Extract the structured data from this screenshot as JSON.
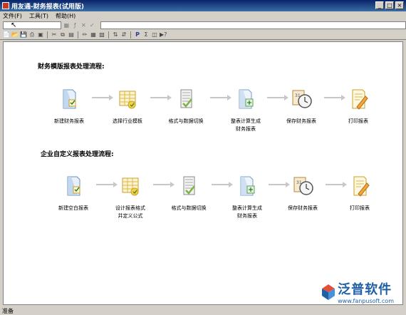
{
  "window": {
    "title": "用友通-财务报表(试用版)",
    "buttons": [
      "_",
      "□",
      "×"
    ]
  },
  "menu": {
    "items": [
      "文件(F)",
      "工具(T)",
      "帮助(H)"
    ]
  },
  "workflow1": {
    "title": "财务模版报表处理流程:",
    "steps": [
      {
        "label": "新建财务报表",
        "icon": "new-report-icon"
      },
      {
        "label": "选择行业模板",
        "icon": "industry-template-icon"
      },
      {
        "label": "格式与数据切换",
        "icon": "format-data-switch-icon"
      },
      {
        "label": "整表计算生成\n财务报表",
        "icon": "calculate-report-icon"
      },
      {
        "label": "保存财务报表",
        "icon": "save-report-icon"
      },
      {
        "label": "打印报表",
        "icon": "print-report-icon"
      }
    ]
  },
  "workflow2": {
    "title": "企业自定义报表处理流程:",
    "steps": [
      {
        "label": "新建空白报表",
        "icon": "new-blank-report-icon"
      },
      {
        "label": "设计报表格式\n并定义公式",
        "icon": "design-format-icon"
      },
      {
        "label": "格式与数据切换",
        "icon": "format-data-switch-icon"
      },
      {
        "label": "整表计算生成\n财务报表",
        "icon": "calculate-report-icon"
      },
      {
        "label": "保存财务报表",
        "icon": "save-report-icon"
      },
      {
        "label": "打印报表",
        "icon": "print-report-icon"
      }
    ]
  },
  "watermark": {
    "name": "泛普软件",
    "url": "www.fanpusoft.com"
  },
  "status": {
    "text": "准备"
  },
  "colors": {
    "titlebar": "#0a246a",
    "accent": "#1f5fa5",
    "arrow": "#bdbdbd"
  }
}
